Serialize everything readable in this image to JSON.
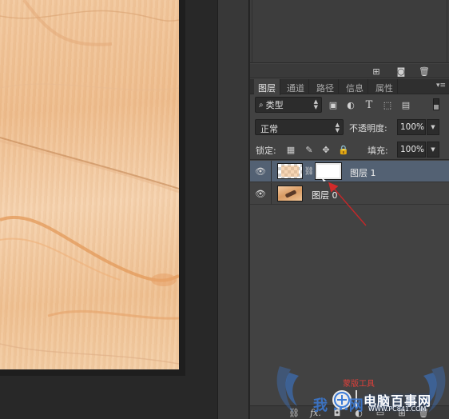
{
  "panel": {
    "tabs": [
      {
        "label": "图层",
        "active": true
      },
      {
        "label": "通道",
        "active": false
      },
      {
        "label": "路径",
        "active": false
      },
      {
        "label": "信息",
        "active": false
      },
      {
        "label": "属性",
        "active": false
      }
    ],
    "menu_icon": "panel-menu-icon",
    "toolbar_icons": [
      "new-layer-icon",
      "camera-icon",
      "trash-icon"
    ]
  },
  "filter": {
    "kind_label": "类型",
    "icons": [
      "image-filter-icon",
      "adjustment-filter-icon",
      "type-filter-icon",
      "shape-filter-icon",
      "smart-object-filter-icon"
    ]
  },
  "blend": {
    "mode": "正常",
    "opacity_label": "不透明度:",
    "opacity_value": "100%"
  },
  "lock": {
    "label": "锁定:",
    "icons": [
      "lock-transparent-icon",
      "lock-paint-icon",
      "lock-move-icon",
      "lock-all-icon"
    ],
    "fill_label": "填充:",
    "fill_value": "100%"
  },
  "layers": [
    {
      "name": "图层 1",
      "selected": true,
      "visible": true,
      "has_mask": true
    },
    {
      "name": "图层 0",
      "selected": false,
      "visible": true,
      "has_mask": false
    }
  ],
  "annotation": {
    "label": "蒙版工具",
    "color": "#e0403a"
  },
  "bottom_bar": {
    "icons": [
      "link-layers-icon",
      "fx-icon",
      "add-mask-icon",
      "adjustment-layer-icon",
      "group-icon",
      "new-layer-icon",
      "delete-layer-icon"
    ],
    "fx_label": "fx."
  },
  "watermark": {
    "brand": "电脑百事网",
    "url": "WWW.PC841.COM",
    "blue_text": "我 ...网"
  },
  "colors": {
    "selected_layer": "#536173",
    "panel_bg": "#424242",
    "canvas_bg": "#282828",
    "wood_base": "#f2c9a0"
  }
}
